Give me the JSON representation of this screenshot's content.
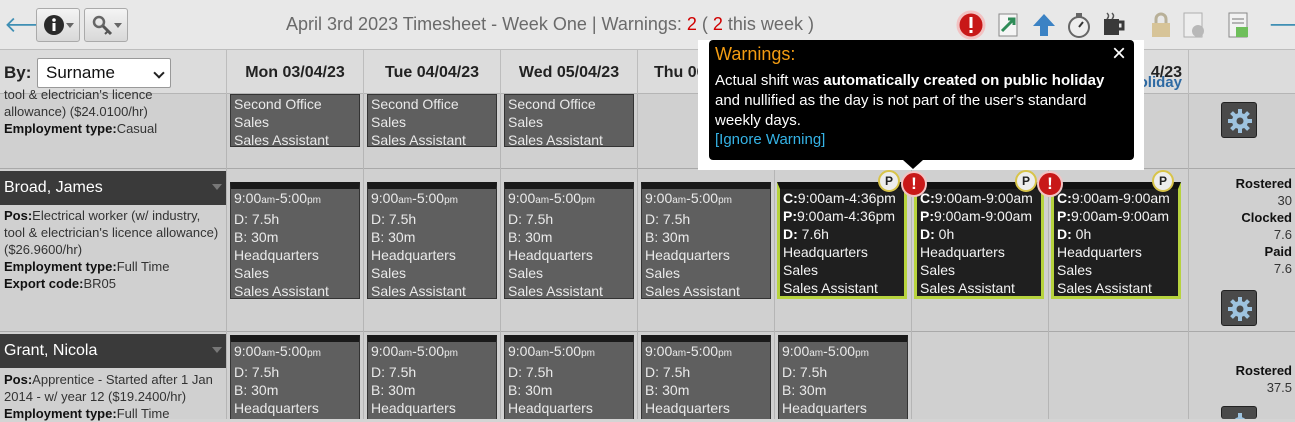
{
  "toolbar": {
    "title_prefix": "April 3rd 2023 Timesheet - Week One | Warnings: ",
    "warnings_total": "2",
    "open_paren": " ( ",
    "warnings_week": "2",
    "this_week": " this week )",
    "icons": [
      "back-arrow-icon",
      "info-icon",
      "key-search-icon",
      "warning-icon",
      "export-icon",
      "upload-icon",
      "stopwatch-icon",
      "coffee-icon",
      "lock-icon",
      "settings-report-icon",
      "report-icon",
      "forward-arrow-icon"
    ]
  },
  "header": {
    "by_label": "By:",
    "by_value": "Surname",
    "days": [
      "Mon 03/04/23",
      "Tue 04/04/23",
      "Wed 05/04/23",
      "Thu 06",
      "",
      "",
      "4/23"
    ],
    "holiday": "oliday"
  },
  "top_employee": {
    "info_line1": "tool & electrician's licence",
    "info_line2": "allowance) ($24.0100/hr)",
    "emp_type_label": "Employment type:",
    "emp_type": "Casual",
    "shifts": [
      {
        "l1": "Second Office",
        "l2": "Sales",
        "l3": "Sales Assistant"
      },
      {
        "l1": "Second Office",
        "l2": "Sales",
        "l3": "Sales Assistant"
      },
      {
        "l1": "Second Office",
        "l2": "Sales",
        "l3": "Sales Assistant"
      }
    ]
  },
  "broad": {
    "name": "Broad, James",
    "pos_label": "Pos:",
    "pos": "Electrical worker (w/ industry, tool & electrician's licence allowance) ($26.9600/hr)",
    "emp_type_label": "Employment type:",
    "emp_type": "Full Time",
    "export_label": "Export code:",
    "export": "BR05",
    "shifts": [
      {
        "time": "9:00",
        "s1": "am",
        "time2": "-5:00",
        "s2": "pm",
        "d": "D: 7.5h",
        "b": "B: 30m",
        "loc": "Headquarters",
        "dept": "Sales",
        "role": "Sales Assistant"
      },
      {
        "time": "9:00",
        "s1": "am",
        "time2": "-5:00",
        "s2": "pm",
        "d": "D: 7.5h",
        "b": "B: 30m",
        "loc": "Headquarters",
        "dept": "Sales",
        "role": "Sales Assistant"
      },
      {
        "time": "9:00",
        "s1": "am",
        "time2": "-5:00",
        "s2": "pm",
        "d": "D: 7.5h",
        "b": "B: 30m",
        "loc": "Headquarters",
        "dept": "Sales",
        "role": "Sales Assistant"
      },
      {
        "time": "9:00",
        "s1": "am",
        "time2": "-5:00",
        "s2": "pm",
        "d": "D: 7.5h",
        "b": "B: 30m",
        "loc": "Headquarters",
        "dept": "Sales",
        "role": "Sales Assistant"
      }
    ],
    "hl_shifts": [
      {
        "c": "9:00am-4:36pm",
        "p": "9:00am-4:36pm",
        "d": "7.6h",
        "loc": "Headquarters",
        "dept": "Sales",
        "role": "Sales Assistant"
      },
      {
        "c": "9:00am-9:00am",
        "p": "9:00am-9:00am",
        "d": "0h",
        "loc": "Headquarters",
        "dept": "Sales",
        "role": "Sales Assistant"
      },
      {
        "c": "9:00am-9:00am",
        "p": "9:00am-9:00am",
        "d": "0h",
        "loc": "Headquarters",
        "dept": "Sales",
        "role": "Sales Assistant"
      }
    ],
    "summary": {
      "rostered_label": "Rostered",
      "rostered": "30",
      "clocked_label": "Clocked",
      "clocked": "7.6",
      "paid_label": "Paid",
      "paid": "7.6"
    }
  },
  "grant": {
    "name": "Grant, Nicola",
    "pos_label": "Pos:",
    "pos": "Apprentice - Started after 1 Jan 2014 - w/ year 12 ($19.2400/hr)",
    "emp_type_label": "Employment type:",
    "emp_type": "Full Time",
    "summary": {
      "rostered_label": "Rostered",
      "rostered": "37.5"
    }
  },
  "tooltip": {
    "title": "Warnings:",
    "text_a": "Actual shift was ",
    "text_b": "automatically created on public holiday",
    "text_c": " and nullified as the day is not part of the user's standard weekly days.",
    "link": "[Ignore Warning]"
  },
  "labels": {
    "c": "C:",
    "p": "P:",
    "d": "D:",
    "p_badge": "P",
    "warn": "!"
  },
  "colors": {
    "accent_green": "#b7d33e",
    "warning_red": "#c81818",
    "tooltip_title": "#f39c12",
    "link_blue": "#35b3e6"
  }
}
